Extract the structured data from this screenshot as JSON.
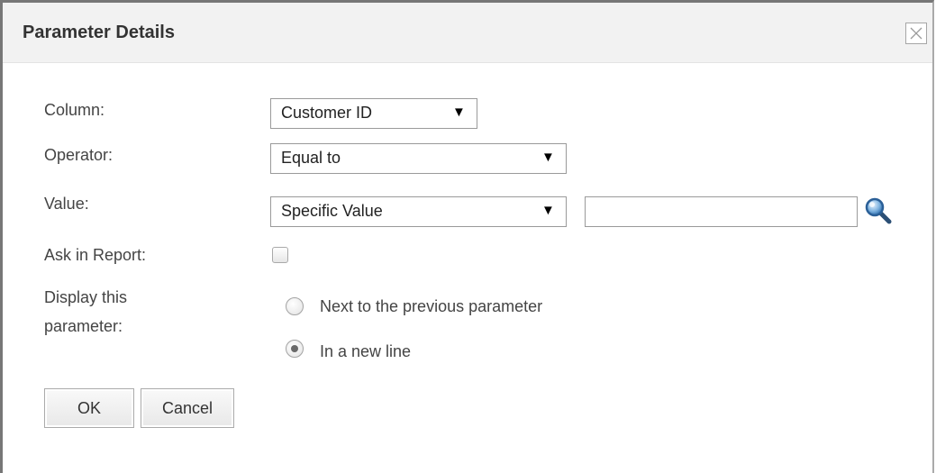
{
  "dialog": {
    "title": "Parameter Details",
    "close_icon": "close-x-icon"
  },
  "form": {
    "column_label": "Column:",
    "column_value": "Customer ID",
    "operator_label": "Operator:",
    "operator_value": "Equal to",
    "value_label": "Value:",
    "value_type": "Specific Value",
    "value_text": "",
    "search_icon": "magnifier-search-icon",
    "ask_label": "Ask in Report:",
    "ask_checked": false,
    "display_label_line1": "Display this",
    "display_label_line2": "parameter:",
    "option_next": "Next to the previous parameter",
    "option_new_line": "In a new line",
    "selected_option": "In a new line",
    "dropdown_caret": "▼"
  },
  "buttons": {
    "ok": "OK",
    "cancel": "Cancel"
  }
}
